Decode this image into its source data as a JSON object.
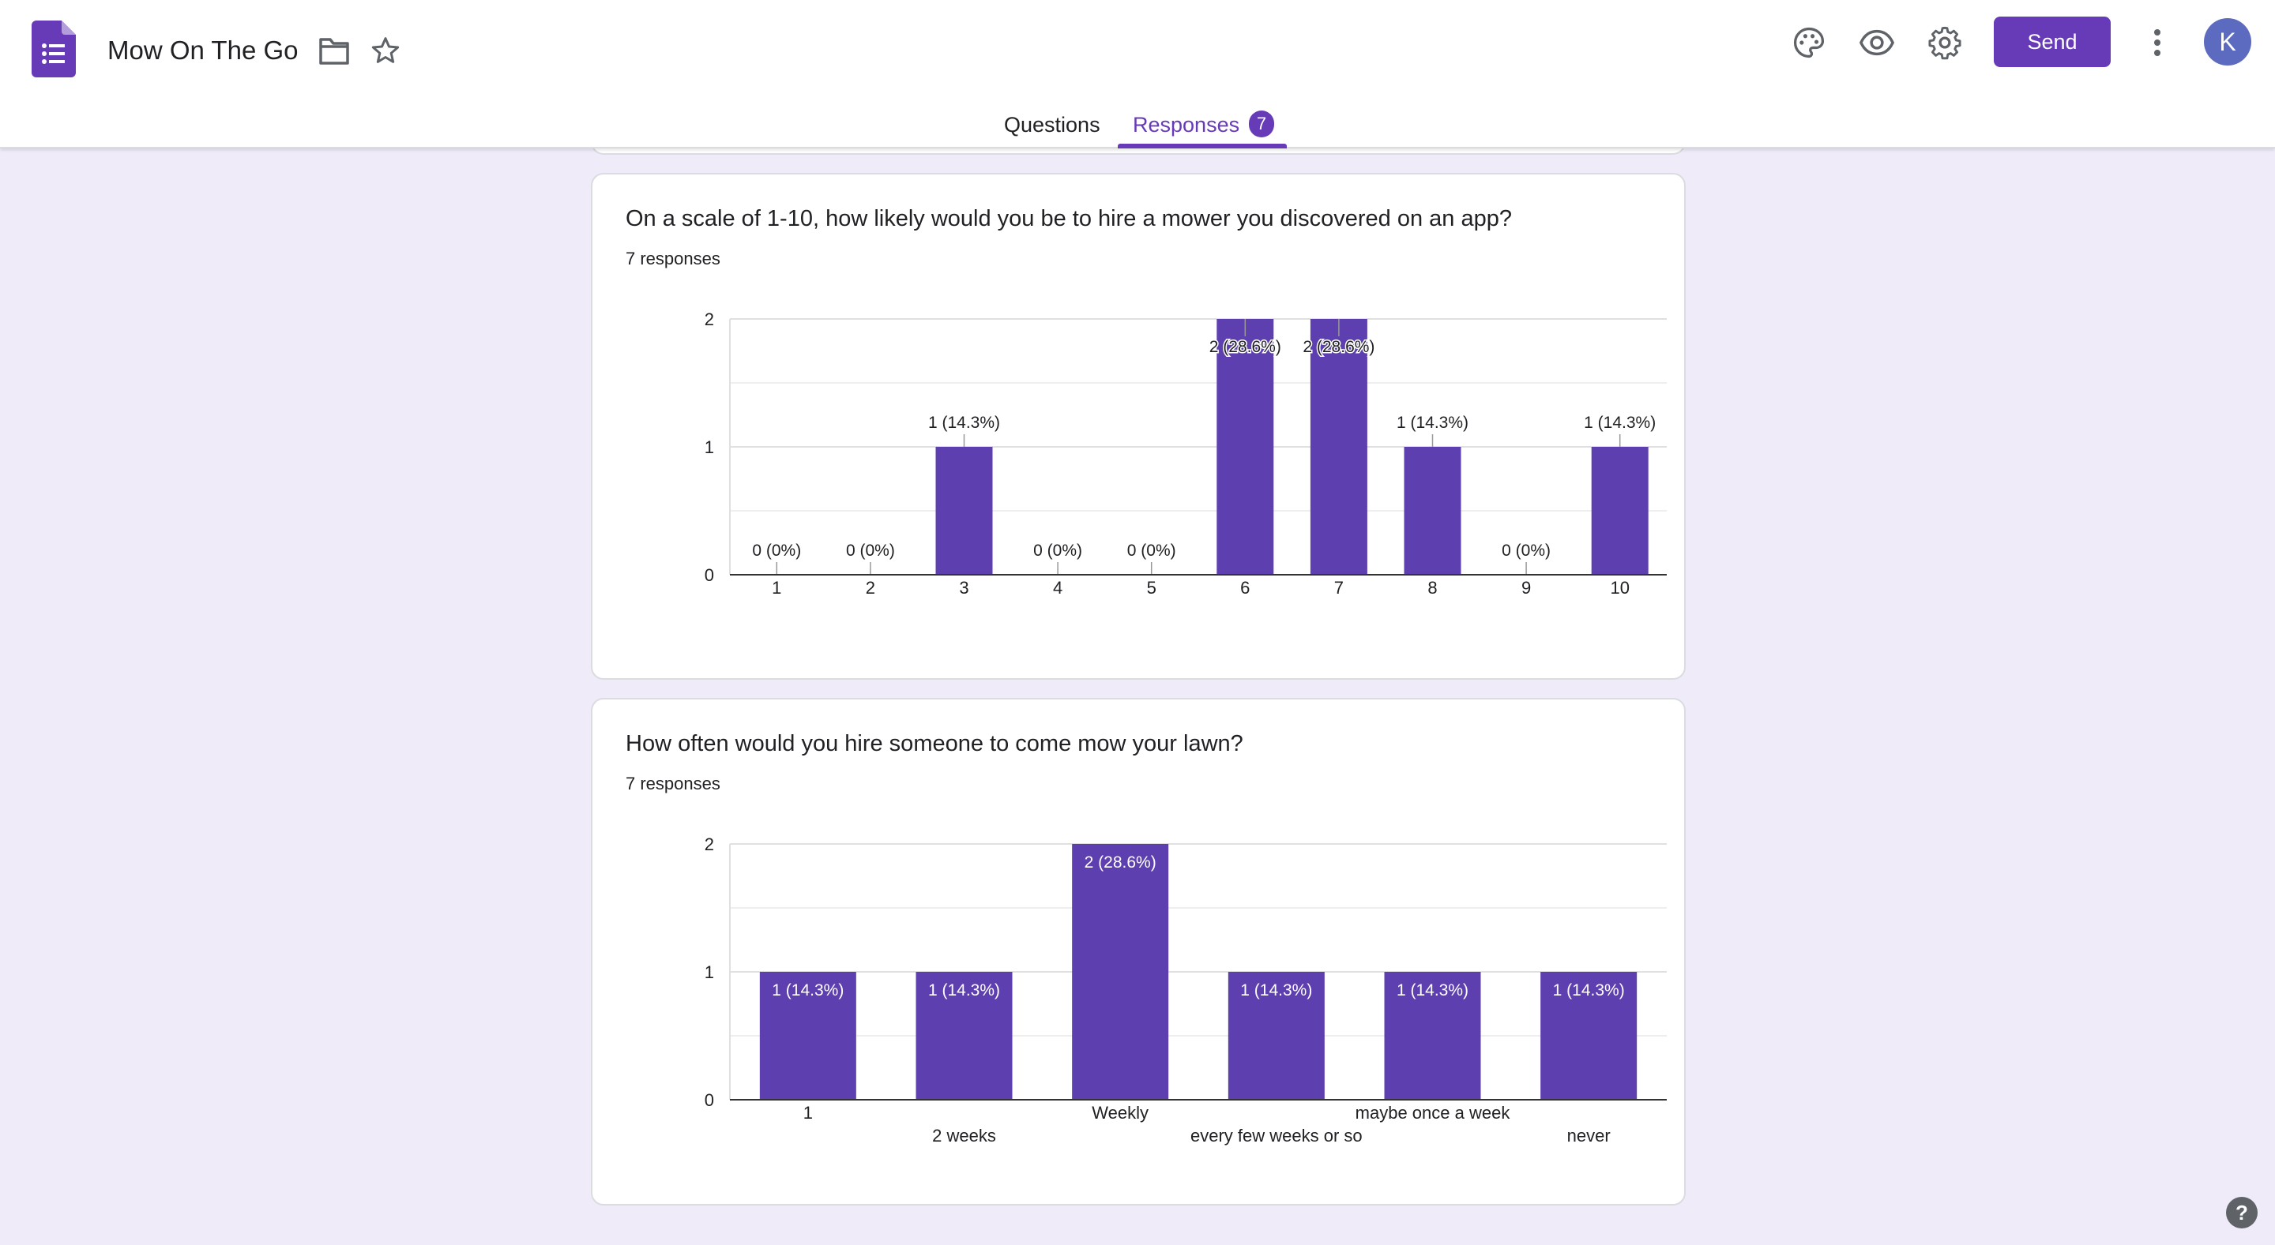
{
  "app": {
    "title": "Mow On The Go",
    "avatar_letter": "K"
  },
  "toolbar": {
    "send_label": "Send"
  },
  "icons": {
    "folder": "folder-icon",
    "star": "star-icon",
    "palette": "palette-icon",
    "preview": "eye-icon",
    "settings": "gear-icon",
    "more": "more-vert-icon",
    "help": "help-icon"
  },
  "tabs": [
    {
      "label": "Questions"
    },
    {
      "label": "Responses",
      "badge": "7"
    }
  ],
  "colors": {
    "accent": "#673ab7",
    "bar": "#5e3fb0",
    "background": "#efebf8"
  },
  "questions": [
    {
      "title": "On a scale of 1-10, how likely would you be to hire a mower you discovered on an app?",
      "responses": "7 responses"
    },
    {
      "title": "How often would you hire someone to come mow your lawn?",
      "responses": "7 responses"
    }
  ],
  "help_label": "?",
  "chart_data": [
    {
      "type": "bar",
      "categories": [
        "1",
        "2",
        "3",
        "4",
        "5",
        "6",
        "7",
        "8",
        "9",
        "10"
      ],
      "values": [
        0,
        0,
        1,
        0,
        0,
        2,
        2,
        1,
        0,
        1
      ],
      "data_labels": [
        "0 (0%)",
        "0 (0%)",
        "1 (14.3%)",
        "0 (0%)",
        "0 (0%)",
        "2 (28.6%)",
        "2 (28.6%)",
        "1 (14.3%)",
        "0 (0%)",
        "1 (14.3%)"
      ],
      "y_ticks": [
        "0",
        "1",
        "2"
      ],
      "ylim": [
        0,
        2
      ],
      "grid": true
    },
    {
      "type": "bar",
      "categories": [
        "1",
        "2 weeks",
        "Weekly",
        "every few weeks or so",
        "maybe once a week",
        "never"
      ],
      "values": [
        1,
        1,
        2,
        1,
        1,
        1
      ],
      "data_labels": [
        "1 (14.3%)",
        "1 (14.3%)",
        "2 (28.6%)",
        "1 (14.3%)",
        "1 (14.3%)",
        "1 (14.3%)"
      ],
      "y_ticks": [
        "0",
        "1",
        "2"
      ],
      "ylim": [
        0,
        2
      ],
      "grid": true
    }
  ]
}
